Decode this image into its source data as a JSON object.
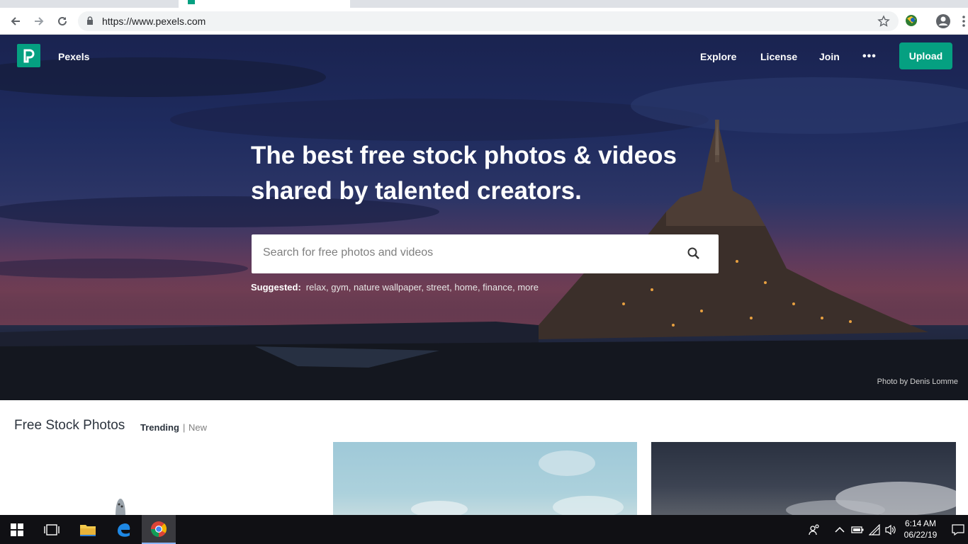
{
  "browser": {
    "url": "https://www.pexels.com"
  },
  "header": {
    "brand": "Pexels",
    "nav": [
      "Explore",
      "License",
      "Join"
    ],
    "more_label": "•••",
    "upload_label": "Upload"
  },
  "hero": {
    "headline": "The best free stock photos & videos shared by talented creators.",
    "search_placeholder": "Search for free photos and videos",
    "suggested_label": "Suggested:",
    "suggestions": [
      "relax",
      "gym",
      "nature wallpaper",
      "street",
      "home",
      "finance",
      "more"
    ],
    "credit": "Photo by Denis Lomme"
  },
  "content": {
    "title": "Free Stock Photos",
    "tab_trending": "Trending",
    "separator": "|",
    "tab_new": "New"
  },
  "taskbar": {
    "time": "6:14 AM",
    "date": "06/22/19"
  },
  "colors": {
    "accent": "#05a081"
  }
}
